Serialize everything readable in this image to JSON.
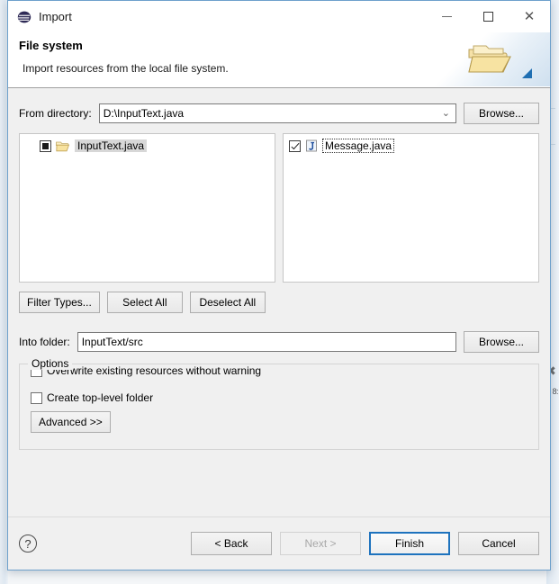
{
  "window": {
    "title": "Import",
    "app_icon": "eclipse-icon",
    "minimize_label": "–",
    "maximize_label": "□",
    "close_label": "✕"
  },
  "header": {
    "title": "File system",
    "subtitle": "Import resources from the local file system.",
    "banner_icon": "open-folder-icon",
    "arrow_icon": "blue-arrow-icon"
  },
  "from_directory": {
    "label": "From directory:",
    "value": "D:\\InputText.java",
    "placeholder": "",
    "browse_label": "Browse...",
    "dropdown_icon": "chevron-down-icon"
  },
  "left_tree": {
    "items": [
      {
        "name": "InputText.java",
        "icon": "folder-icon",
        "checkbox_state": "partial",
        "selected": true
      }
    ]
  },
  "right_tree": {
    "items": [
      {
        "name": "Message.java",
        "icon": "java-file-icon",
        "checkbox_state": "checked",
        "focused": true
      }
    ]
  },
  "selection_buttons": {
    "filter_types": "Filter Types...",
    "select_all": "Select All",
    "deselect_all": "Deselect All"
  },
  "into_folder": {
    "label": "Into folder:",
    "value": "InputText/src",
    "placeholder": "",
    "browse_label": "Browse..."
  },
  "options": {
    "group_title": "Options",
    "overwrite_label": "Overwrite existing resources without warning",
    "overwrite_checked": false,
    "create_top_level_label": "Create top-level folder",
    "create_top_level_checked": false,
    "advanced_label": "Advanced >>"
  },
  "footer": {
    "help_label": "?",
    "back_label": "< Back",
    "next_label": "Next >",
    "next_disabled": true,
    "finish_label": "Finish",
    "finish_is_default": true,
    "cancel_label": "Cancel"
  },
  "background": {
    "artifact_x": "✖",
    "artifact_text": "8:"
  },
  "colors": {
    "dialog_border": "#6ea1cc",
    "body_bg": "#f0f0f0",
    "default_button_border": "#1e73be",
    "title_bar_bg": "#ffffff",
    "selection_bg": "#d7d7d7"
  }
}
